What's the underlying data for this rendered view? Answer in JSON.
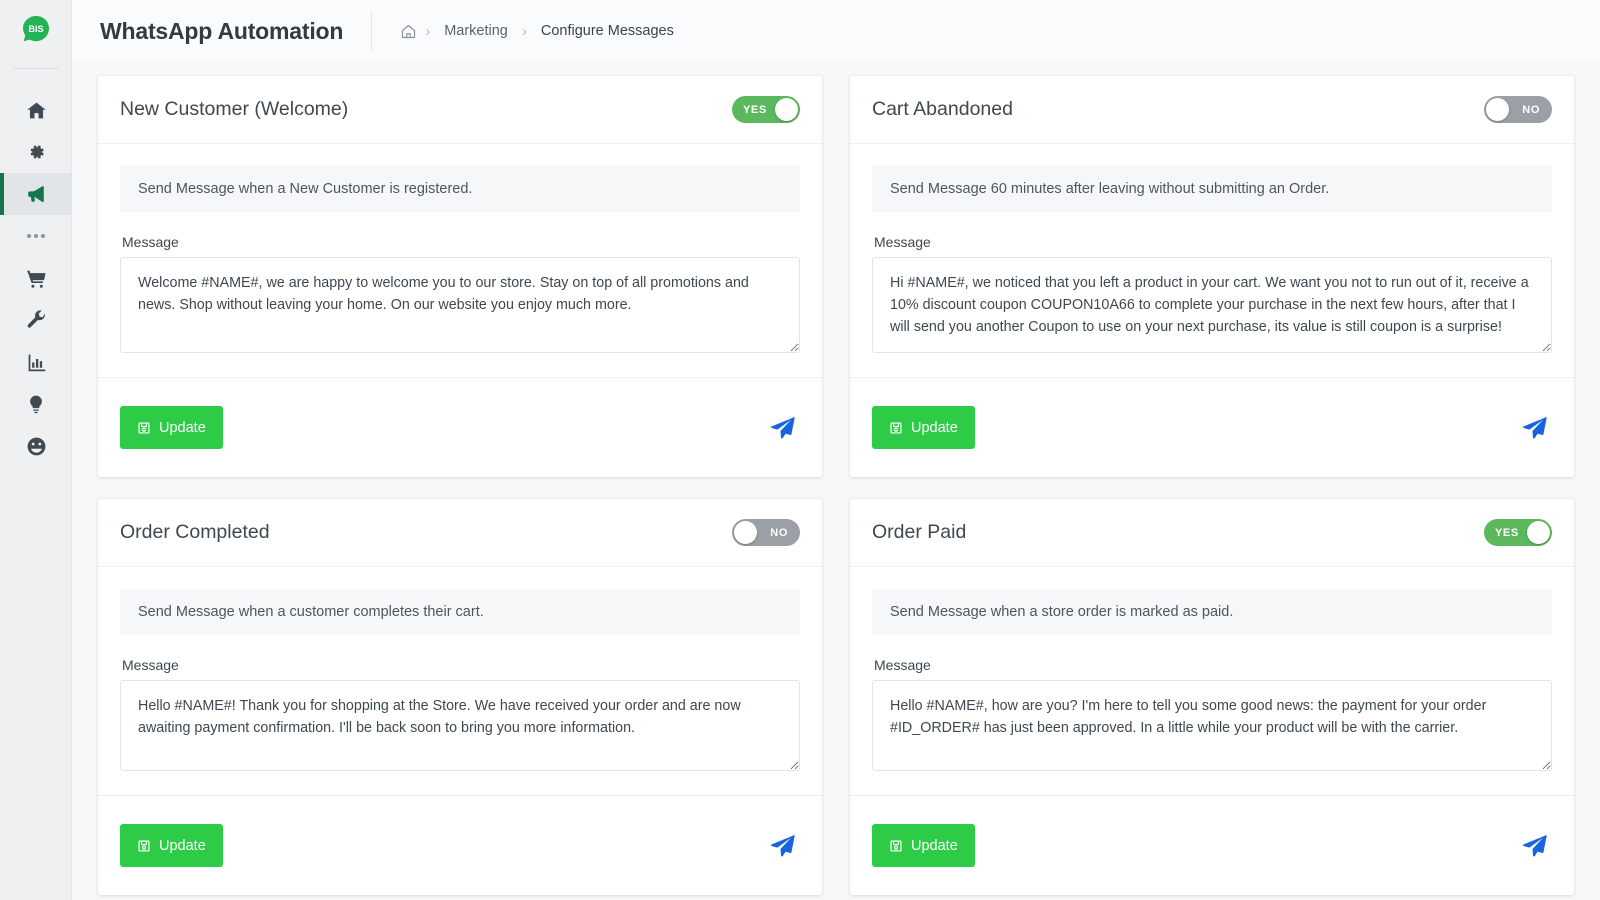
{
  "brand": {
    "logo_text": "BIS",
    "logo_color": "#22b455",
    "icon": "whatsapp-bubble-icon"
  },
  "header": {
    "title": "WhatsApp Automation",
    "breadcrumb": {
      "home_icon": "home-icon",
      "separator": "›",
      "items": [
        {
          "label": "Marketing"
        },
        {
          "label": "Configure Messages"
        }
      ]
    }
  },
  "sidebar": {
    "items": [
      {
        "icon": "home-icon",
        "name": "sidebar-item-home",
        "active": false
      },
      {
        "icon": "gear-icon",
        "name": "sidebar-item-settings",
        "active": false
      },
      {
        "icon": "megaphone-icon",
        "name": "sidebar-item-marketing",
        "active": true
      },
      {
        "icon": "ellipsis-icon",
        "name": "sidebar-item-more",
        "active": false
      },
      {
        "icon": "shopping-cart-icon",
        "name": "sidebar-item-orders",
        "active": false
      },
      {
        "icon": "wrench-icon",
        "name": "sidebar-item-tools",
        "active": false
      },
      {
        "icon": "bar-chart-icon",
        "name": "sidebar-item-stats",
        "active": false
      },
      {
        "icon": "lightbulb-icon",
        "name": "sidebar-item-ideas",
        "active": false
      },
      {
        "icon": "smiley-icon",
        "name": "sidebar-item-support",
        "active": false
      }
    ],
    "active_color": "#12774b"
  },
  "labels": {
    "message_label": "Message",
    "update_label": "Update",
    "update_icon": "save-icon",
    "send_icon": "paper-plane-icon",
    "toggle_on": "YES",
    "toggle_off": "NO"
  },
  "colors": {
    "toggle_on": "#5cb85c",
    "toggle_off": "#9aa0a6",
    "update_button": "#2ecb46",
    "send_icon": "#1763e0",
    "page_background": "#f6f7f9"
  },
  "cards": [
    {
      "title": "New Customer (Welcome)",
      "enabled": true,
      "toggle_state": "YES",
      "description": "Send Message when a New Customer is registered.",
      "message": "Welcome #NAME#, we are happy to welcome you to our store. Stay on top of all promotions and news. Shop without leaving your home. On our website you enjoy much more."
    },
    {
      "title": "Cart Abandoned",
      "enabled": false,
      "toggle_state": "NO",
      "description": "Send Message 60 minutes after leaving without submitting an Order.",
      "message": "Hi #NAME#, we noticed that you left a product in your cart. We want you not to run out of it, receive a 10% discount coupon COUPON10A66 to complete your purchase in the next few hours, after that I will send you another Coupon to use on your next purchase, its value is still coupon is a surprise!"
    },
    {
      "title": "Order Completed",
      "enabled": false,
      "toggle_state": "NO",
      "description": "Send Message when a customer completes their cart.",
      "message": "Hello #NAME#! Thank you for shopping at the Store. We have received your order and are now awaiting payment confirmation. I'll be back soon to bring you more information."
    },
    {
      "title": "Order Paid",
      "enabled": true,
      "toggle_state": "YES",
      "description": "Send Message when a store order is marked as paid.",
      "message": "Hello #NAME#, how are you? I'm here to tell you some good news: the payment for your order #ID_ORDER# has just been approved. In a little while your product will be with the carrier."
    }
  ]
}
